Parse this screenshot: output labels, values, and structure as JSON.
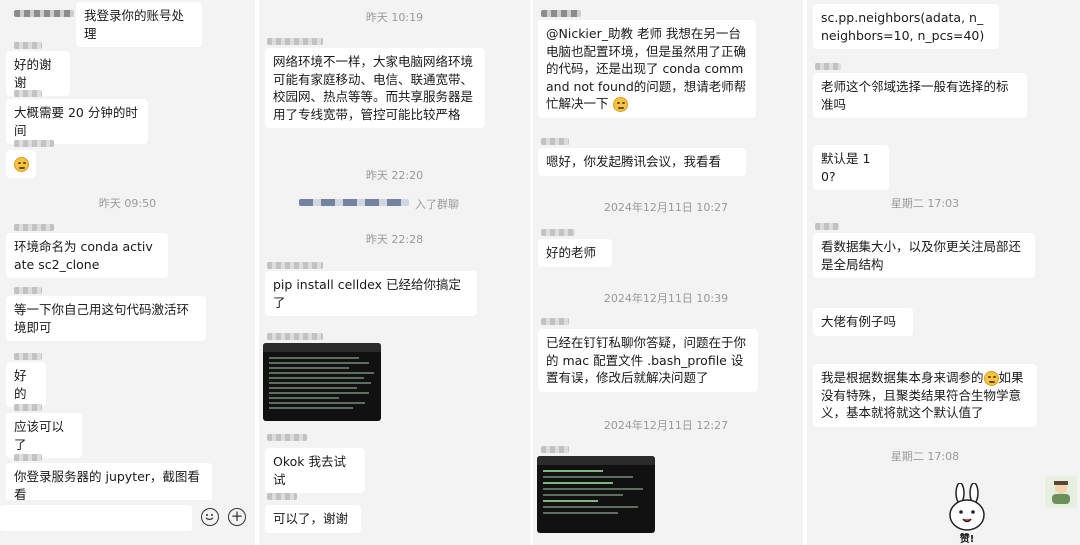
{
  "panel1": {
    "msg_top": "我登录你的账号处理",
    "msg_thanks": "好的谢谢",
    "msg_20min": "大概需要 20 分钟的时间",
    "time_0950": "昨天 09:50",
    "msg_env": "环境命名为 conda activate sc2_clone",
    "msg_activate": "等一下你自己用这句代码激活环境即可",
    "msg_ok": "好的",
    "msg_should": "应该可以了",
    "msg_jupyter": "你登录服务器的 jupyter，截图看看"
  },
  "panel2": {
    "time_1019": "昨天 10:19",
    "msg_network": "网络环境不一样，大家电脑网络环境可能有家庭移动、电信、联通宽带、校园网、热点等等。而共享服务器是用了专线宽带，管控可能比较严格",
    "time_2220": "昨天 22:20",
    "system_joined": "入了群聊",
    "time_2228": "昨天 22:28",
    "msg_celldex": "pip install celldex 已经给你搞定了",
    "msg_okok": "Okok 我去试试",
    "msg_fine": "可以了，谢谢"
  },
  "panel3": {
    "msg_question": "@Nickier_助教 老师 我想在另一台电脑也配置环境，但是虽然用了正确的代码，还是出现了 conda command not found的问题，想请老师帮忙解决一下",
    "msg_meeting": "嗯好，你发起腾讯会议，我看看",
    "time_1027": "2024年12月11日 10:27",
    "msg_goodteacher": "好的老师",
    "time_1039": "2024年12月11日 10:39",
    "msg_dingtalk": "已经在钉钉私聊你答疑，问题在于你的 mac 配置文件 .bash_profile 设置有误，修改后就解决问题了",
    "time_1227": "2024年12月11日 12:27"
  },
  "panel4": {
    "msg_code": "sc.pp.neighbors(adata, n_neighbors=10, n_pcs=40)",
    "msg_neighbor": "老师这个邻域选择一般有选择的标准吗",
    "msg_default": "默认是 10?",
    "time_tue1": "星期二 17:03",
    "msg_size": "看数据集大小，以及你更关注局部还是全局结构",
    "msg_example": "大佬有例子吗",
    "msg_adjust_a": "我是根据数据集本身来调参的",
    "msg_adjust_b": "如果没有特殊，且聚类结果符合生物学意义，基本就将就这个默认值了",
    "time_tue2": "星期二 17:08",
    "sticker_text": "赞!"
  }
}
